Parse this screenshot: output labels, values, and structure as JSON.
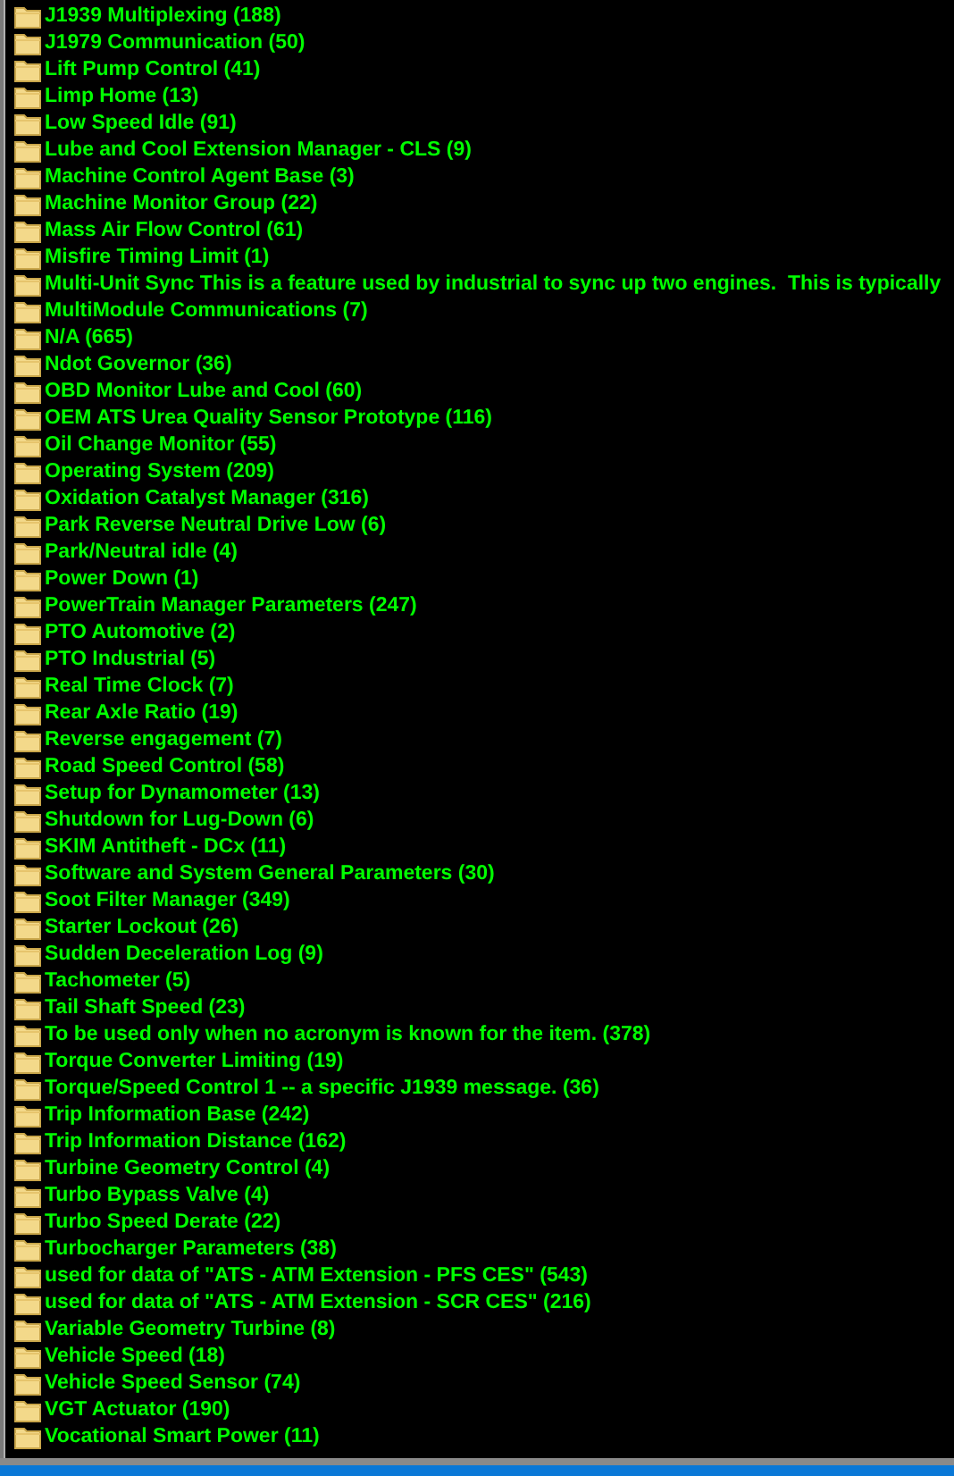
{
  "tree": {
    "items": [
      {
        "label": "J1939 Multiplexing (188)"
      },
      {
        "label": "J1979 Communication (50)"
      },
      {
        "label": "Lift Pump Control (41)"
      },
      {
        "label": "Limp Home (13)"
      },
      {
        "label": "Low Speed Idle (91)"
      },
      {
        "label": "Lube and Cool Extension Manager - CLS (9)"
      },
      {
        "label": "Machine Control Agent Base (3)"
      },
      {
        "label": "Machine Monitor Group (22)"
      },
      {
        "label": "Mass Air Flow Control (61)"
      },
      {
        "label": "Misfire Timing Limit (1)"
      },
      {
        "label": "Multi-Unit Sync This is a feature used by industrial to sync up two engines.  This is typically"
      },
      {
        "label": "MultiModule Communications (7)"
      },
      {
        "label": "N/A (665)"
      },
      {
        "label": "Ndot Governor (36)"
      },
      {
        "label": "OBD Monitor Lube and Cool (60)"
      },
      {
        "label": "OEM ATS Urea Quality Sensor Prototype (116)"
      },
      {
        "label": "Oil Change Monitor (55)"
      },
      {
        "label": "Operating System (209)"
      },
      {
        "label": "Oxidation Catalyst Manager (316)"
      },
      {
        "label": "Park Reverse Neutral Drive Low (6)"
      },
      {
        "label": "Park/Neutral idle (4)"
      },
      {
        "label": "Power Down (1)"
      },
      {
        "label": "PowerTrain Manager Parameters (247)"
      },
      {
        "label": "PTO Automotive (2)"
      },
      {
        "label": "PTO Industrial (5)"
      },
      {
        "label": "Real Time Clock (7)"
      },
      {
        "label": "Rear Axle Ratio (19)"
      },
      {
        "label": "Reverse engagement (7)"
      },
      {
        "label": "Road Speed Control (58)"
      },
      {
        "label": "Setup for Dynamometer (13)"
      },
      {
        "label": "Shutdown for Lug-Down (6)"
      },
      {
        "label": "SKIM Antitheft - DCx (11)"
      },
      {
        "label": "Software and System General Parameters (30)"
      },
      {
        "label": "Soot Filter Manager (349)"
      },
      {
        "label": "Starter Lockout (26)"
      },
      {
        "label": "Sudden Deceleration Log (9)"
      },
      {
        "label": "Tachometer (5)"
      },
      {
        "label": "Tail Shaft Speed (23)"
      },
      {
        "label": "To be used only when no acronym is known for the item. (378)"
      },
      {
        "label": "Torque Converter Limiting (19)"
      },
      {
        "label": "Torque/Speed Control 1 -- a specific J1939 message. (36)"
      },
      {
        "label": "Trip Information Base (242)"
      },
      {
        "label": "Trip Information Distance (162)"
      },
      {
        "label": "Turbine Geometry Control (4)"
      },
      {
        "label": "Turbo Bypass Valve (4)"
      },
      {
        "label": "Turbo Speed Derate (22)"
      },
      {
        "label": "Turbocharger Parameters (38)"
      },
      {
        "label": "used for data of \"ATS - ATM Extension - PFS CES\" (543)"
      },
      {
        "label": "used for data of \"ATS - ATM Extension - SCR CES\" (216)"
      },
      {
        "label": "Variable Geometry Turbine (8)"
      },
      {
        "label": "Vehicle Speed (18)"
      },
      {
        "label": "Vehicle Speed Sensor (74)"
      },
      {
        "label": "VGT Actuator (190)"
      },
      {
        "label": "Vocational Smart Power (11)"
      }
    ]
  }
}
